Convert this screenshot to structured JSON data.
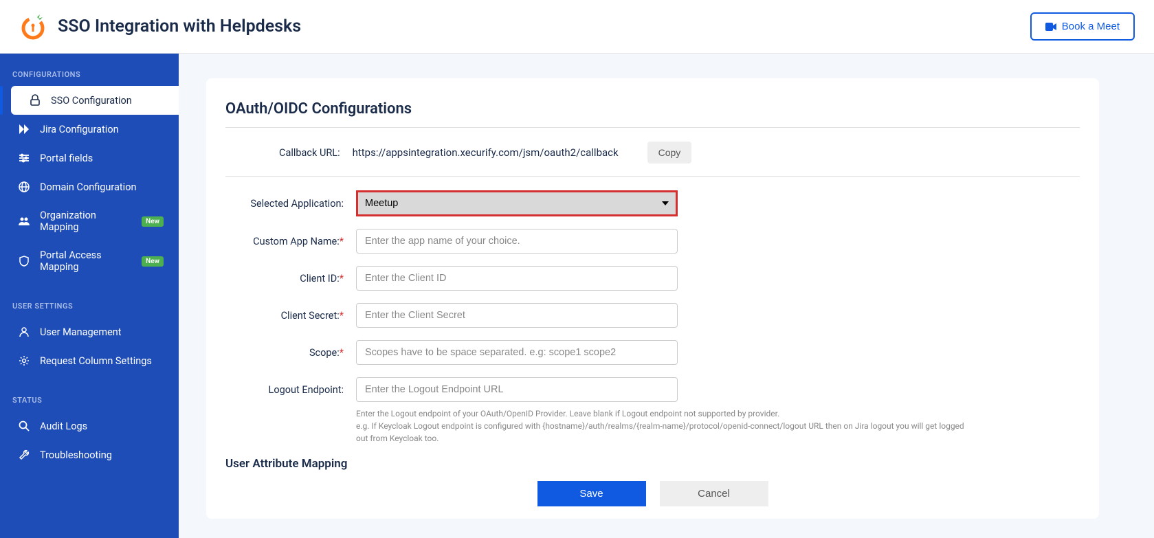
{
  "header": {
    "title": "SSO Integration with Helpdesks",
    "book_meet": "Book a Meet"
  },
  "sidebar": {
    "sections": {
      "configurations": "CONFIGURATIONS",
      "user_settings": "USER SETTINGS",
      "status": "STATUS"
    },
    "items": {
      "sso_config": "SSO Configuration",
      "jira_config": "Jira Configuration",
      "portal_fields": "Portal fields",
      "domain_config": "Domain Configuration",
      "org_mapping": "Organization Mapping",
      "portal_access": "Portal Access Mapping",
      "user_mgmt": "User Management",
      "req_col": "Request Column Settings",
      "audit_logs": "Audit Logs",
      "troubleshoot": "Troubleshooting"
    },
    "badge_new": "New"
  },
  "main": {
    "title": "OAuth/OIDC Configurations",
    "callback_label": "Callback URL:",
    "callback_value": "https://appsintegration.xecurify.com/jsm/oauth2/callback",
    "copy": "Copy",
    "fields": {
      "selected_app": {
        "label": "Selected Application:",
        "value": "Meetup"
      },
      "custom_app": {
        "label": "Custom App Name:",
        "placeholder": "Enter the app name of your choice."
      },
      "client_id": {
        "label": "Client ID:",
        "placeholder": "Enter the Client ID"
      },
      "client_secret": {
        "label": "Client Secret:",
        "placeholder": "Enter the Client Secret"
      },
      "scope": {
        "label": "Scope:",
        "placeholder": "Scopes have to be space separated. e.g: scope1 scope2"
      },
      "logout": {
        "label": "Logout Endpoint:",
        "placeholder": "Enter the Logout Endpoint URL"
      }
    },
    "logout_helper_1": "Enter the Logout endpoint of your OAuth/OpenID Provider. Leave blank if Logout endpoint not supported by provider.",
    "logout_helper_2": "e.g. If Keycloak Logout endpoint is configured with {hostname}/auth/realms/{realm-name}/protocol/openid-connect/logout URL then on Jira logout you will get logged out from Keycloak too.",
    "subsection": "User Attribute Mapping",
    "save": "Save",
    "cancel": "Cancel"
  }
}
